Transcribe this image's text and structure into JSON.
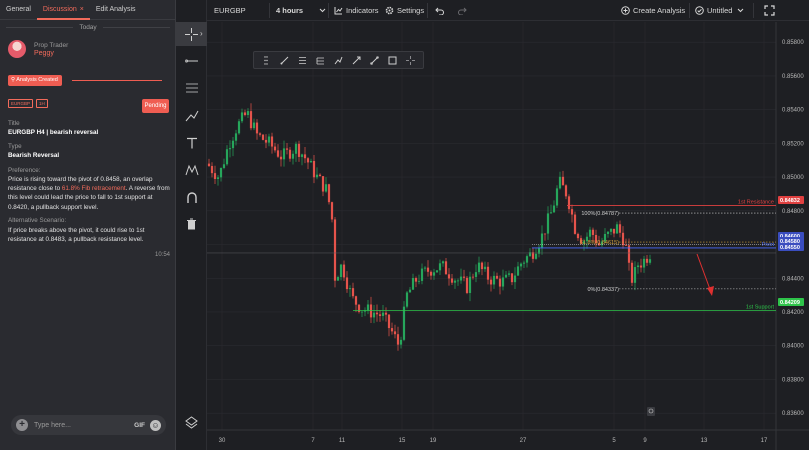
{
  "left_panel": {
    "tabs": [
      {
        "label": "General"
      },
      {
        "label": "Discussion",
        "close": "×"
      },
      {
        "label": "Edit Analysis"
      }
    ],
    "divider_label": "Today",
    "user": {
      "role": "Prop Trader",
      "name": "Peggy"
    },
    "status": "Analysis Created",
    "badges": [
      "EURGBP",
      "1H"
    ],
    "pending_label": "Pending",
    "title_label": "Title",
    "title_value": "EURGBP H4 | bearish reversal",
    "type_label": "Type",
    "type_value": "Bearish Reversal",
    "preference_label": "Preference:",
    "preference_before": "Price is rising toward the pivot of 0.8458, an overlap resistance close to ",
    "preference_highlight": "61.8% Fib retracement",
    "preference_after": ". A reverse from this level could lead the price to fall to 1st support at 0.8420, a pullback support level.",
    "alt_label": "Alternative Scenario:",
    "alt_text": "If price breaks above the pivot, it could rise to 1st resistance at 0.8483, a pullback resistance level.",
    "message_time": "10:54",
    "composer": {
      "placeholder": "Type here...",
      "gif": "GIF",
      "plus": "+",
      "emoji": "☺"
    }
  },
  "rail": {
    "icons": [
      "crosshair-icon",
      "horizontal-line-icon",
      "channel-icon",
      "brush-icon",
      "text-icon",
      "pattern-icon",
      "magnet-icon",
      "trash-icon",
      "layers-icon"
    ],
    "expand": "›"
  },
  "topbar": {
    "symbol": "EURGBP",
    "interval": "4 hours",
    "indicators": "Indicators",
    "settings": "Settings",
    "create_analysis": "Create Analysis",
    "layout_name": "Untitled"
  },
  "chart_data": {
    "type": "candlestick",
    "x_tick_labels": [
      "30",
      "7",
      "11",
      "15",
      "19",
      "27",
      "5",
      "9",
      "13",
      "17"
    ],
    "y_tick_labels": [
      "0.83600",
      "0.83800",
      "0.84000",
      "0.84200",
      "0.84400",
      "0.84600",
      "0.84800",
      "0.85000",
      "0.85200",
      "0.85400",
      "0.85600",
      "0.85800"
    ],
    "ylim": [
      0.835,
      0.8592
    ],
    "levels": [
      {
        "label": "1st Resistance",
        "price": 0.84832,
        "color": "#e04040"
      },
      {
        "label": "Pivot",
        "price": 0.8458,
        "color": "#4a6bff"
      },
      {
        "label": "1st Support",
        "price": 0.84209,
        "color": "#2ec44a"
      }
    ],
    "price_tags": [
      {
        "value": "0.84832",
        "color": "#e04040"
      },
      {
        "value": "0.84600",
        "color": "#3a4dbf"
      },
      {
        "value": "0.84580",
        "color": "#3a4dbf"
      },
      {
        "value": "0.84550",
        "color": "#3a4dbf"
      },
      {
        "value": "0.84209",
        "color": "#2ec44a"
      }
    ],
    "fib": [
      {
        "label": "100%(0.84787)",
        "price": 0.84787
      },
      {
        "label": "61.8%(0.84615)",
        "price": 0.84615
      },
      {
        "label": "0%(0.84337)",
        "price": 0.84337
      }
    ],
    "colors": {
      "up": "#26a65b",
      "down": "#e5534b",
      "background": "#1e1f23",
      "grid": "#2a2b30"
    }
  }
}
